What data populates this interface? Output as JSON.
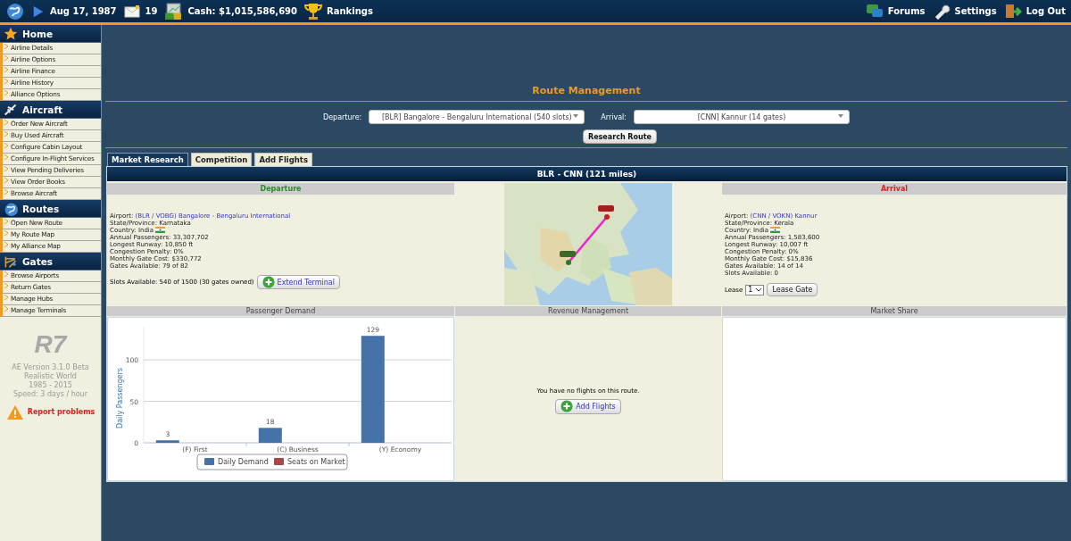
{
  "top_bar": {
    "date": "Aug 17, 1987",
    "messages": "19",
    "cash": "Cash: $1,015,586,690",
    "rankings": "Rankings",
    "links": [
      "Forums",
      "Settings",
      "Log Out"
    ]
  },
  "sidebar": {
    "sections": [
      {
        "title": "Home",
        "items": [
          "Airline Details",
          "Airline Options",
          "Airline Finance",
          "Airline History",
          "Alliance Options"
        ]
      },
      {
        "title": "Aircraft",
        "items": [
          "Order New Aircraft",
          "Buy Used Aircraft",
          "Configure Cabin Layout",
          "Configure In-Flight Services",
          "View Pending Deliveries",
          "View Order Books",
          "Browse Aircraft"
        ]
      },
      {
        "title": "Routes",
        "items": [
          "Open New Route",
          "My Route Map",
          "My Alliance Map"
        ]
      },
      {
        "title": "Gates",
        "items": [
          "Browse Airports",
          "Return Gates",
          "Manage Hubs",
          "Manage Terminals"
        ]
      }
    ],
    "logo": "R7",
    "info": [
      "AE Version 3.1.0 Beta",
      "Realistic World",
      "1985 - 2015",
      "Speed: 3 days / hour"
    ],
    "report": "Report problems"
  },
  "route_form": {
    "title": "Route Management",
    "departure_label": "Departure:",
    "departure_value": "[BLR] Bangalore - Bengaluru International (540 slots)",
    "arrival_label": "Arrival:",
    "arrival_value": "[CNN] Kannur (14 gates)",
    "research_button": "Research Route"
  },
  "tabs": [
    {
      "label": "Market Research",
      "selected": true
    },
    {
      "label": "Competition",
      "selected": false
    },
    {
      "label": "Add Flights",
      "selected": false
    }
  ],
  "route_title": "BLR - CNN (121 miles)",
  "departure": {
    "heading": "Departure",
    "fields": [
      {
        "label": "Airport:",
        "value": "(BLR / VOBG) Bangalore - Bengaluru International",
        "kind": "link"
      },
      {
        "label": "State/Province:",
        "value": "Karnataka",
        "kind": "text"
      },
      {
        "label": "Country:",
        "value": "India",
        "kind": "flag"
      },
      {
        "label": "Annual Passengers:",
        "value": "33,307,702",
        "kind": "text"
      },
      {
        "label": "Longest Runway:",
        "value": "10,850 ft",
        "kind": "text"
      },
      {
        "label": "Congestion Penalty:",
        "value": "0%",
        "kind": "text"
      },
      {
        "label": "Monthly Gate Cost:",
        "value": "$330,772",
        "kind": "text"
      },
      {
        "label": "Gates Available:",
        "value": "79 of 82",
        "kind": "text"
      }
    ],
    "slots": "Slots Available: 540 of 1500 (30 gates owned)",
    "button": "Extend Terminal"
  },
  "arrival": {
    "heading": "Arrival",
    "fields": [
      {
        "label": "Airport:",
        "value": "(CNN / VOKN) Kannur",
        "kind": "link"
      },
      {
        "label": "State/Province:",
        "value": "Kerala",
        "kind": "text"
      },
      {
        "label": "Country:",
        "value": "India",
        "kind": "flag"
      },
      {
        "label": "Annual Passengers:",
        "value": "1,583,600",
        "kind": "text"
      },
      {
        "label": "Longest Runway:",
        "value": "10,007 ft",
        "kind": "text"
      },
      {
        "label": "Congestion Penalty:",
        "value": "0%",
        "kind": "text"
      },
      {
        "label": "Monthly Gate Cost:",
        "value": "$15,836",
        "kind": "text"
      },
      {
        "label": "Gates Available:",
        "value": "14 of 14",
        "kind": "text"
      },
      {
        "label": "Slots Available:",
        "value": "0",
        "kind": "text"
      }
    ],
    "lease_label": "Lease",
    "lease_value": "1",
    "button": "Lease Gate"
  },
  "passenger_demand": {
    "heading": "Passenger Demand",
    "chart_data": {
      "type": "bar",
      "ylabel": "Daily Passengers",
      "categories": [
        "(F) First",
        "(C) Business",
        "(Y) Economy"
      ],
      "series": [
        {
          "name": "Daily Demand",
          "color": "#4572a7",
          "values": [
            3,
            18,
            129
          ]
        },
        {
          "name": "Seats on Market",
          "color": "#aa4643",
          "values": [
            null,
            null,
            null
          ]
        }
      ],
      "ylim": [
        0,
        140
      ],
      "yticks": [
        0,
        50,
        100
      ],
      "data_labels": true
    }
  },
  "revenue_management": {
    "heading": "Revenue Management",
    "message": "You have no flights on this route.",
    "button": "Add Flights"
  },
  "market_share": {
    "heading": "Market Share"
  }
}
